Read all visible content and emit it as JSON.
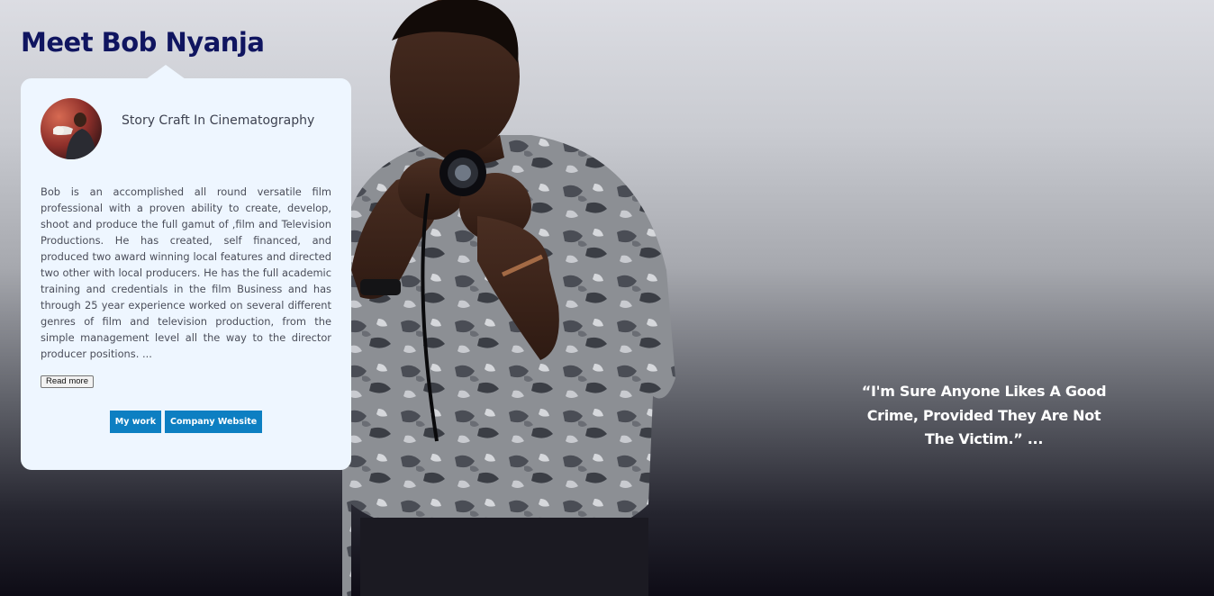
{
  "page": {
    "title": "Meet Bob Nyanja"
  },
  "card": {
    "subtitle": "Story Craft In Cinematography",
    "bio": "Bob is an accomplished all round versatile film professional with a proven ability to create, develop, shoot and produce the full gamut of ,film and Television Productions. He has created, self financed, and produced two award winning local features and directed two other with local producers. He has the full academic training and credentials in the film Business and has through 25 year experience worked on several different genres of film and television production, from the simple management level all the way to the director producer positions. ...",
    "read_more_label": "Read more",
    "buttons": {
      "my_work": "My work",
      "company_website": "Company Website"
    }
  },
  "quote": {
    "text": "“I'm Sure Anyone Likes A Good Crime, Provided They Are Not The Victim.” ..."
  },
  "colors": {
    "title": "#101560",
    "card_background": "#eef6ff",
    "button": "#0d7fc2",
    "quote_text": "#ffffff"
  },
  "icons": {
    "avatar": "avatar-photo",
    "hero": "hero-photo"
  }
}
